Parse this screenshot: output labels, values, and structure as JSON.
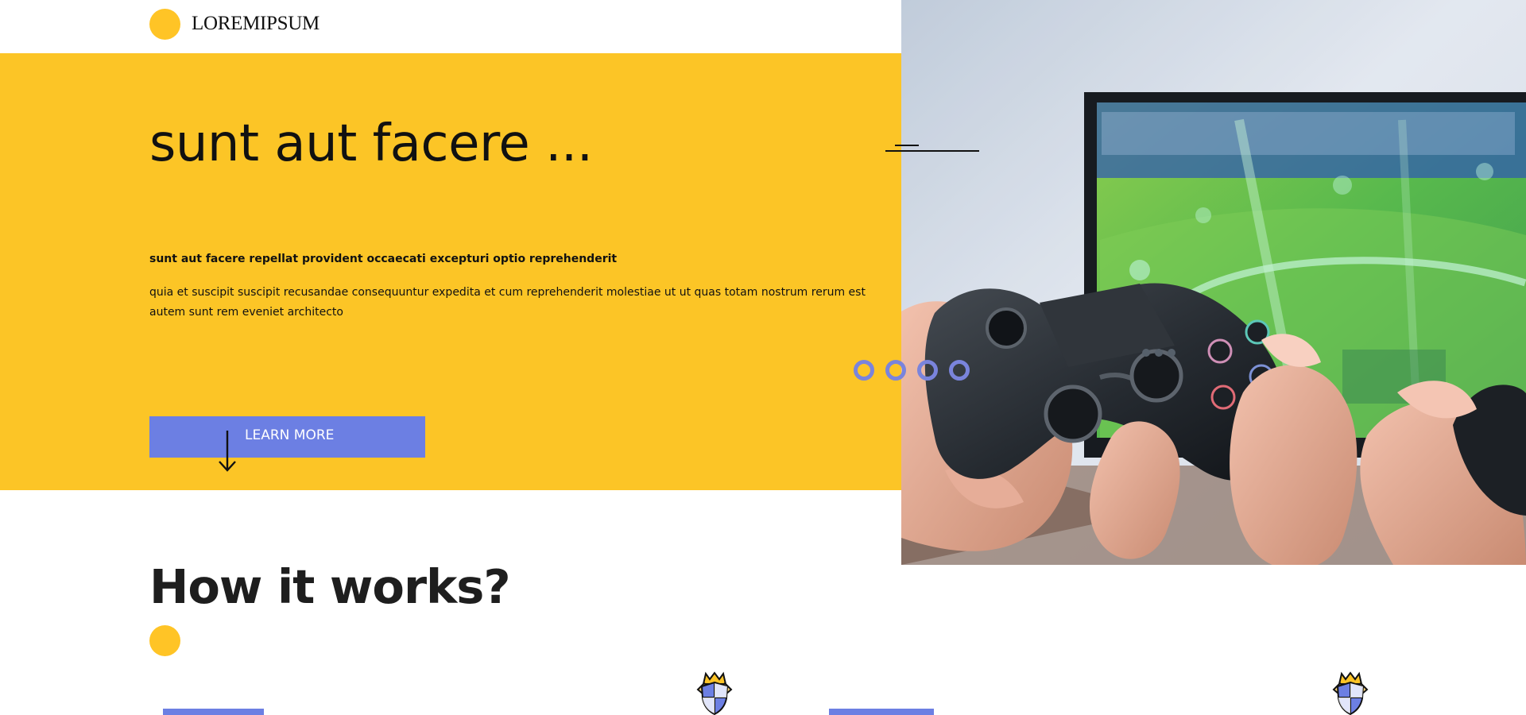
{
  "header": {
    "logo_text": "LOREMIPSUM"
  },
  "hero": {
    "title": "sunt aut facere ...",
    "subtitle": "sunt aut facere repellat provident occaecati excepturi optio reprehenderit",
    "body": "quia et suscipit suscipit recusandae consequuntur expedita et cum reprehenderit molestiae ut ut quas totam nostrum rerum est autem sunt rem eveniet architecto",
    "cta_label": "LEARN MORE"
  },
  "carousel": {
    "dot_count": 4
  },
  "section": {
    "title": "How it works?"
  },
  "icons": {
    "arrow": "arrow-down-icon",
    "badge": "shield-crown-icon"
  },
  "colors": {
    "yellow": "#fcc526",
    "blue": "#6c7fe3",
    "dark": "#111111"
  }
}
